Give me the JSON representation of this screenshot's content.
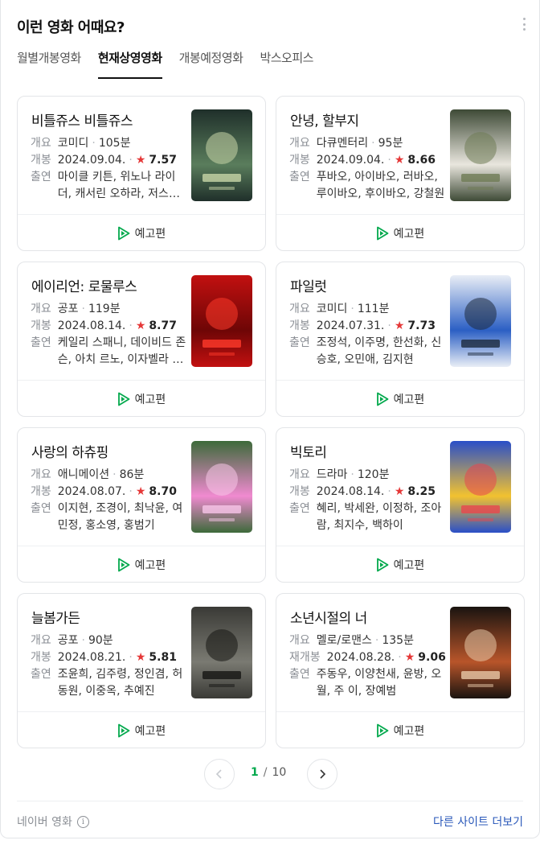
{
  "header": {
    "title": "이런 영화 어때요?"
  },
  "tabs": [
    {
      "label": "월별개봉영화",
      "active": false
    },
    {
      "label": "현재상영영화",
      "active": true
    },
    {
      "label": "개봉예정영화",
      "active": false
    },
    {
      "label": "박스오피스",
      "active": false
    }
  ],
  "labels": {
    "genre": "개요",
    "release": "개봉",
    "rerelease": "재개봉",
    "cast": "출연",
    "trailer": "예고편"
  },
  "movies": [
    {
      "title": "비틀쥬스 비틀쥬스",
      "genre": "코미디",
      "runtime": "105분",
      "date_label": "개봉",
      "date": "2024.09.04.",
      "rating": "7.57",
      "cast": "마이클 키튼, 위노나 라이더, 캐서린 오하라, 저스틴 서룩스",
      "poster_colors": [
        "#1f2f2a",
        "#5a7d5c",
        "#c8d6a8"
      ]
    },
    {
      "title": "안녕, 할부지",
      "genre": "다큐멘터리",
      "runtime": "95분",
      "date_label": "개봉",
      "date": "2024.09.04.",
      "rating": "8.66",
      "cast": "푸바오, 아이바오, 러바오, 루이바오, 후이바오, 강철원",
      "poster_colors": [
        "#3e4a36",
        "#e9e6de",
        "#6f7c55"
      ]
    },
    {
      "title": "에이리언: 로물루스",
      "genre": "공포",
      "runtime": "119분",
      "date_label": "개봉",
      "date": "2024.08.14.",
      "rating": "8.77",
      "cast": "케일리 스패니, 데이비드 존슨, 아치 르노, 이자벨라 메르세드",
      "poster_colors": [
        "#c21010",
        "#6e0606",
        "#ff3a2a"
      ]
    },
    {
      "title": "파일럿",
      "genre": "코미디",
      "runtime": "111분",
      "date_label": "개봉",
      "date": "2024.07.31.",
      "rating": "7.73",
      "cast": "조정석, 이주명, 한선화, 신승호, 오민애, 김지현",
      "poster_colors": [
        "#e9eef6",
        "#2b5fc4",
        "#1d2a3d"
      ]
    },
    {
      "title": "사랑의 하츄핑",
      "genre": "애니메이션",
      "runtime": "86분",
      "date_label": "개봉",
      "date": "2024.08.07.",
      "rating": "8.70",
      "cast": "이지현, 조경이, 최낙윤, 여민정, 홍소영, 홍범기",
      "poster_colors": [
        "#3d6a3a",
        "#f08ad0",
        "#f7c6e8"
      ]
    },
    {
      "title": "빅토리",
      "genre": "드라마",
      "runtime": "120분",
      "date_label": "개봉",
      "date": "2024.08.14.",
      "rating": "8.25",
      "cast": "혜리, 박세완, 이정하, 조아람, 최지수, 백하이",
      "poster_colors": [
        "#2a4fc8",
        "#f2c230",
        "#e8464e"
      ]
    },
    {
      "title": "늘봄가든",
      "genre": "공포",
      "runtime": "90분",
      "date_label": "개봉",
      "date": "2024.08.21.",
      "rating": "5.81",
      "cast": "조윤희, 김주령, 정인겸, 허동원, 이중옥, 추예진",
      "poster_colors": [
        "#3a3a36",
        "#7a7a72",
        "#151513"
      ]
    },
    {
      "title": "소년시절의 너",
      "genre": "멜로/로맨스",
      "runtime": "135분",
      "date_label": "재개봉",
      "date": "2024.08.28.",
      "rating": "9.06",
      "cast": "주동우, 이양천새, 윤방, 오월, 주 이, 장예범",
      "poster_colors": [
        "#1a1410",
        "#b8552a",
        "#e8c8a8"
      ]
    }
  ],
  "pagination": {
    "current": "1",
    "separator": "/",
    "total": "10"
  },
  "footer": {
    "source": "네이버 영화",
    "more_link": "다른 사이트 더보기"
  },
  "colors": {
    "accent_green": "#03a94d",
    "star_red": "#e53838",
    "link_blue": "#2857b9"
  }
}
